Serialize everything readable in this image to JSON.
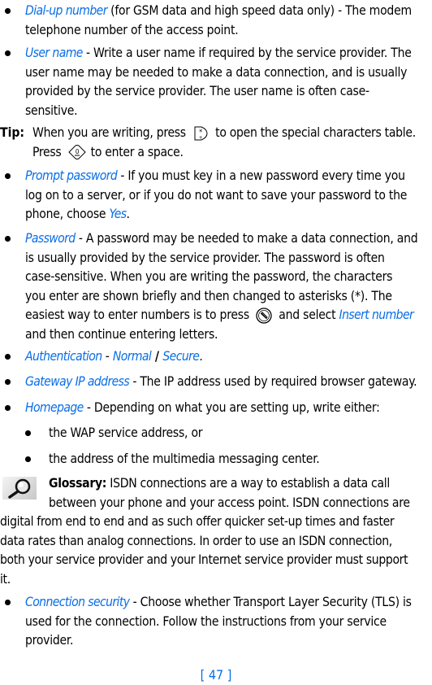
{
  "items": [
    {
      "term": "Dial-up number",
      "lines": [
        " (for GSM data and high speed data only) - The modem",
        "telephone number of the access point."
      ]
    },
    {
      "term": "User name",
      "lines": [
        " - Write a user name if required by the service provider. The",
        "user name may be needed to make a data connection, and is usually",
        "provided by the service provider. The user name is often case-",
        "sensitive."
      ]
    },
    {
      "term": "Prompt password",
      "lines": [
        " - If you must key in a new password every time you",
        "log on to a server, or if you do not want to save your password to the",
        "phone, choose "
      ],
      "option": "Yes",
      "end": "."
    },
    {
      "term": "Password",
      "lines": [
        " - A password may be needed to make a data connection, and",
        "is usually provided by the service provider. The password is often",
        "case-sensitive. When you are writing the password, the characters",
        "you enter are shown briefly and then changed to asterisks (*). The",
        "easiest way to enter numbers is to press "
      ],
      "after_key": " and select ",
      "option": "Insert number",
      "last_line": "and then continue entering letters."
    },
    {
      "term": "Authentication",
      "sep": " - ",
      "opt1": "Normal",
      "slash": " / ",
      "opt2": "Secure",
      "end": "."
    },
    {
      "term": "Gateway IP address",
      "lines": [
        " - The IP address used by required browser gateway."
      ]
    },
    {
      "term": "Homepage",
      "lines": [
        " - Depending on what you are setting up, write either:"
      ]
    },
    {
      "term": "Connection security",
      "lines": [
        " - Choose whether Transport Layer Security (TLS) is",
        "used for the connection. Follow the instructions from your service",
        "provider."
      ]
    }
  ],
  "sub_items": [
    "the WAP service address, or",
    "the address of the multimedia messaging center."
  ],
  "tip": {
    "label": "Tip:",
    "line1_a": "When you are writing, press ",
    "line1_b": " to open the special characters table.",
    "line2_a": "Press ",
    "line2_b": " to enter a space.",
    "key1": "star-key",
    "key2": "zero-key"
  },
  "glossary": {
    "label": "Glossary:",
    "line1": " ISDN connections are a way to establish a data call",
    "line2": "between your phone and your access point. ISDN connections are",
    "line3": "digital from end to end and as such offer quicker set-up times and faster",
    "line4": "data rates than analog connections. In order to use an ISDN connection,",
    "line5": "both your service provider and your Internet service provider must support",
    "line6": "it."
  },
  "page_number": "[ 47 ]",
  "colors": {
    "accent": "#0a6ee6",
    "text": "#000000"
  }
}
